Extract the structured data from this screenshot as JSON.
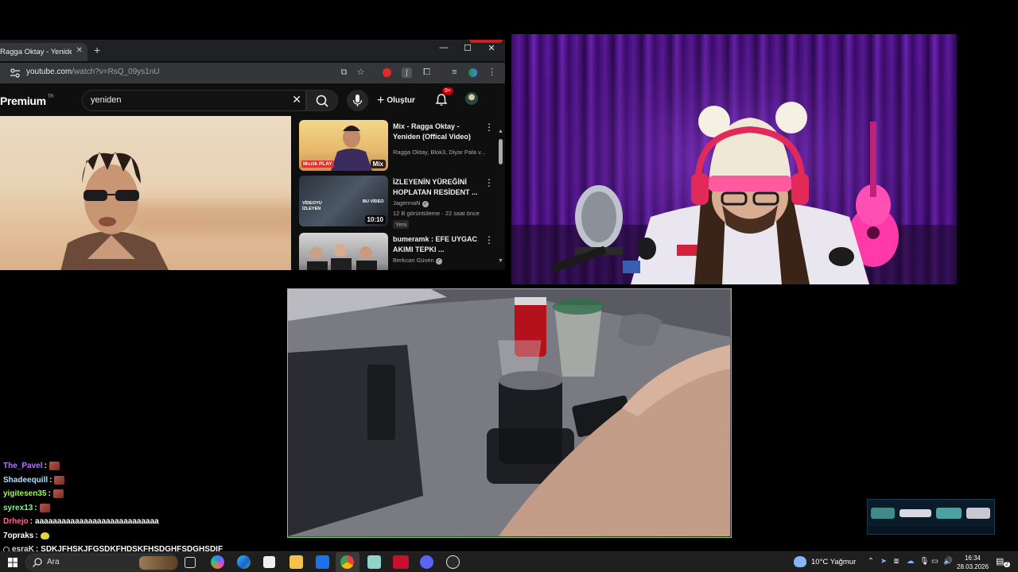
{
  "browser": {
    "tab_title": "Ragga Oktay - Yeniden (Of",
    "url_host": "youtube.com",
    "url_path": "/watch?v=RsQ_09ys1nU"
  },
  "youtube": {
    "logo": "Premium",
    "logo_region": "TR",
    "search_query": "yeniden",
    "create_label": "Oluştur",
    "notifications": "9+"
  },
  "related": [
    {
      "title": "Mix - Ragga Oktay - Yeniden (Offical Video)",
      "meta": "Ragga Oktay, Blok3, Diyar Pala v...",
      "thumb_label": "Mix",
      "thumb_brand": "Muzik PLAY"
    },
    {
      "title": "İZLEYENİN YÜREĞİNİ HOPLATAN RESİDENT ...",
      "channel": "JagermaN",
      "stats": "12 B görüntüleme · 22 saat önce",
      "badge": "Yeni",
      "duration": "10:10",
      "thumb_text_1": "VİDEOYU İZLEYEN",
      "thumb_text_2": "BU VİDEO"
    },
    {
      "title": "bumeramk : EFE UYGAC AKIMI TEPKI ...",
      "channel": "Berkcan Güven"
    }
  ],
  "chat": [
    {
      "user": "The_Pavel",
      "color": "#b974ff",
      "emote": "red",
      "msg": ""
    },
    {
      "user": "Shadeequill",
      "color": "#a7e3ff",
      "emote": "red",
      "msg": ""
    },
    {
      "user": "yigitesen35",
      "color": "#9cff4a",
      "emote": "red",
      "msg": ""
    },
    {
      "user": "syrex13",
      "color": "#7cff7c",
      "emote": "red",
      "msg": ""
    },
    {
      "user": "Drhejo",
      "color": "#ff6a8a",
      "emote": "",
      "msg": "aaaaaaaaaaaaaaaaaaaaaaaaaaaa"
    },
    {
      "user": "7opraks",
      "color": "#ffffff",
      "emote": "yellow",
      "msg": ""
    },
    {
      "user": "esraK",
      "color": "#dcdcdc",
      "emote": "",
      "msg": "SDKJFHSKJFGSDKFHDSKFHSDGHFSDGHSDIF"
    }
  ],
  "taskbar": {
    "search_label": "Ara",
    "weather": "10°C  Yağmur",
    "time": "16:34",
    "date": "28.03.2026",
    "notif_count": "2"
  }
}
